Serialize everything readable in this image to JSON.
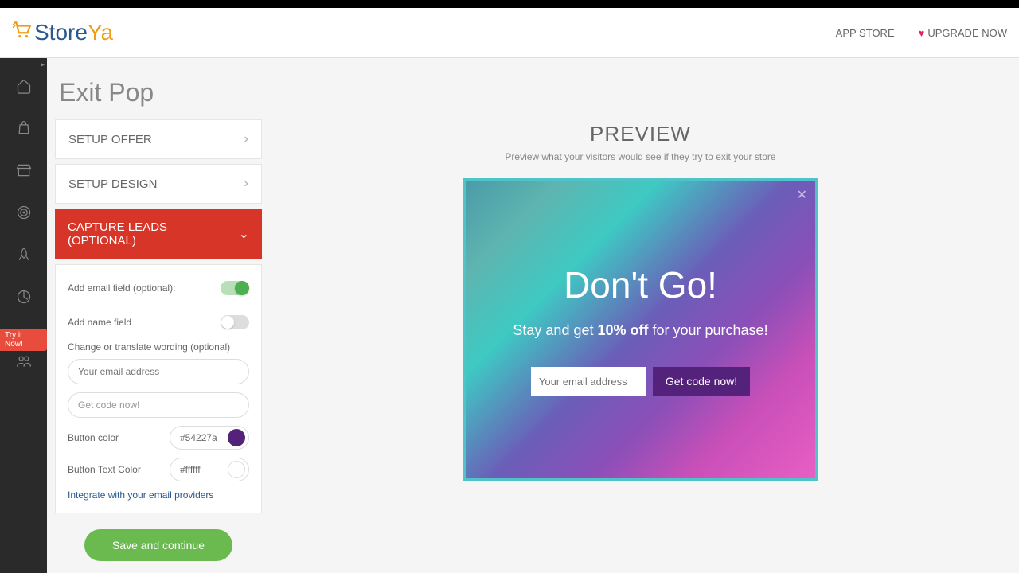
{
  "header": {
    "logo_store": "Store",
    "logo_ya": "Ya",
    "app_store": "APP STORE",
    "upgrade": "UPGRADE NOW"
  },
  "sidebar": {
    "try_it": "Try it Now!"
  },
  "page": {
    "title": "Exit Pop"
  },
  "accordion": {
    "setup_offer": "SETUP OFFER",
    "setup_design": "SETUP DESIGN",
    "capture_leads": "CAPTURE LEADS (OPTIONAL)"
  },
  "form": {
    "add_email_label": "Add email field (optional):",
    "add_name_label": "Add name field",
    "wording_label": "Change or translate wording (optional)",
    "email_placeholder": "Your email address",
    "button_text_value": "Get code now!",
    "button_color_label": "Button color",
    "button_color_value": "#54227a",
    "button_text_color_label": "Button Text Color",
    "button_text_color_value": "#ffffff",
    "integrate_link": "Integrate with your email providers",
    "save_button": "Save and continue"
  },
  "preview": {
    "title": "PREVIEW",
    "subtitle": "Preview what your visitors would see if they try to exit your store",
    "popup_title": "Don't Go!",
    "popup_sub_pre": "Stay and get ",
    "popup_sub_bold": "10% off",
    "popup_sub_post": " for your purchase!",
    "popup_input_placeholder": "Your email address",
    "popup_button": "Get code now!"
  },
  "colors": {
    "button_swatch": "#54227a",
    "text_swatch": "#ffffff"
  }
}
